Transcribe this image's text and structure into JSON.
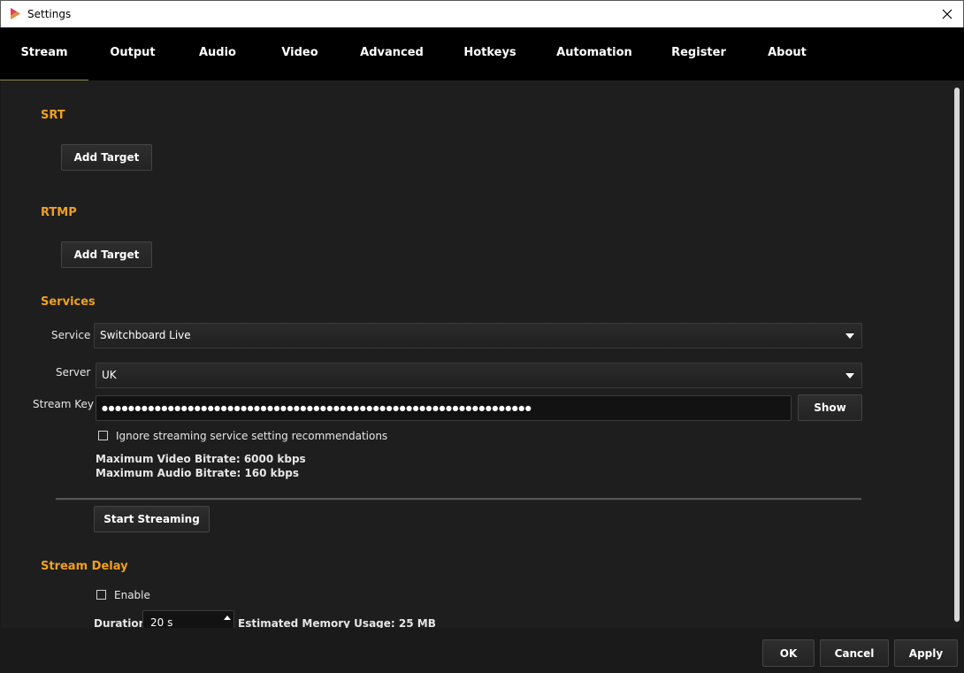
{
  "window": {
    "title": "Settings",
    "icon": "app-logo-icon",
    "close_icon": "close-icon"
  },
  "tabs": [
    {
      "label": "Stream",
      "active": true
    },
    {
      "label": "Output",
      "active": false
    },
    {
      "label": "Audio",
      "active": false
    },
    {
      "label": "Video",
      "active": false
    },
    {
      "label": "Advanced",
      "active": false
    },
    {
      "label": "Hotkeys",
      "active": false
    },
    {
      "label": "Automation",
      "active": false
    },
    {
      "label": "Register",
      "active": false
    },
    {
      "label": "About",
      "active": false
    }
  ],
  "srt": {
    "title": "SRT",
    "add_target_label": "Add Target"
  },
  "rtmp": {
    "title": "RTMP",
    "add_target_label": "Add Target"
  },
  "services": {
    "title": "Services",
    "service_label": "Service",
    "service_value": "Switchboard Live",
    "server_label": "Server",
    "server_value": "UK",
    "stream_key_label": "Stream Key",
    "stream_key_value": "●●●●●●●●●●●●●●●●●●●●●●●●●●●●●●●●●●●●●●●●●●●●●●●●●●●●●●●●●●●●●●●●●",
    "show_label": "Show",
    "ignore_label": "Ignore streaming service setting recommendations",
    "ignore_checked": false,
    "max_video_bitrate": "Maximum Video Bitrate: 6000 kbps",
    "max_audio_bitrate": "Maximum Audio Bitrate: 160 kbps",
    "start_streaming_label": "Start Streaming"
  },
  "stream_delay": {
    "title": "Stream Delay",
    "enable_label": "Enable",
    "enable_checked": false,
    "duration_label": "Duration",
    "duration_value": "20 s",
    "memory_usage": "Estimated Memory Usage: 25 MB"
  },
  "footer": {
    "ok_label": "OK",
    "cancel_label": "Cancel",
    "apply_label": "Apply"
  },
  "colors": {
    "accent": "#f0a020",
    "background": "#1e1e1e",
    "tabbar": "#000000"
  }
}
